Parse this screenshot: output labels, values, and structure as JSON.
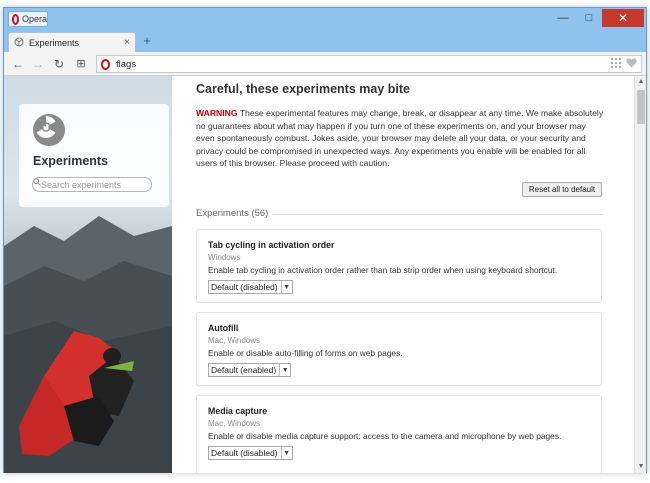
{
  "window": {
    "app_label": "Opera",
    "min_glyph": "—",
    "max_glyph": "□",
    "close_glyph": "✕"
  },
  "tabs": [
    {
      "label": "Experiments",
      "close_glyph": "×",
      "active": true
    }
  ],
  "new_tab_glyph": "+",
  "toolbar": {
    "back_glyph": "←",
    "forward_glyph": "→",
    "reload_glyph": "↻",
    "speed_dial_glyph": "⊞",
    "address": "flags"
  },
  "sidebar": {
    "title": "Experiments",
    "search_placeholder": "Search experiments"
  },
  "main": {
    "heading": "Careful, these experiments may bite",
    "warning_label": "WARNING",
    "warning_text": " These experimental features may change, break, or disappear at any time. We make absolutely no guarantees about what may happen if you turn one of these experiments on, and your browser may even spontaneously combust. Jokes aside, your browser may delete all your data, or your security and privacy could be compromised in unexpected ways. Any experiments you enable will be enabled for all users of this browser. Please proceed with caution.",
    "reset_label": "Reset all to default",
    "experiments_count_label": "Experiments (56)"
  },
  "experiments": [
    {
      "name": "Tab cycling in activation order",
      "platforms": "Windows",
      "description": "Enable tab cycling in activation order rather than tab strip order when using keyboard shortcut.",
      "value": "Default (disabled)"
    },
    {
      "name": "Autofill",
      "platforms": "Mac, Windows",
      "description": "Enable or disable auto-filling of forms on web pages.",
      "value": "Default (enabled)"
    },
    {
      "name": "Media capture",
      "platforms": "Mac, Windows",
      "description": "Enable or disable media capture support: access to the camera and microphone by web pages.",
      "value": "Default (disabled)"
    }
  ],
  "colors": {
    "opera_red": "#cc0f16",
    "warning_red": "#c80000",
    "frame_blue": "#8fc3ee",
    "close_red": "#c7392f"
  }
}
